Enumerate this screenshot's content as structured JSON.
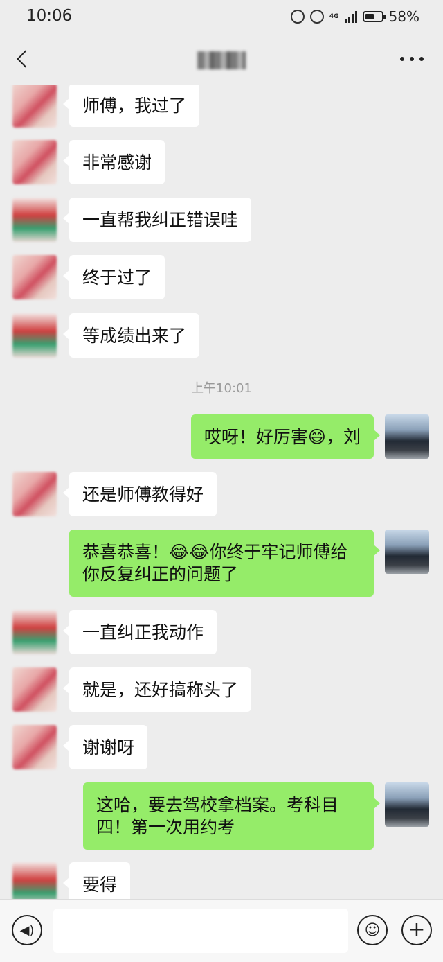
{
  "status": {
    "time": "10:06",
    "battery": "58%",
    "network": "4G"
  },
  "nav": {
    "title": ""
  },
  "chat": {
    "timestamp": "上午10:01",
    "messages": [
      {
        "side": "left",
        "text": "师傅，我过了"
      },
      {
        "side": "left",
        "text": "非常感谢"
      },
      {
        "side": "left",
        "text": "一直帮我纠正错误哇"
      },
      {
        "side": "left",
        "text": "终于过了"
      },
      {
        "side": "left",
        "text": "等成绩出来了"
      },
      {
        "side": "right",
        "text": "哎呀！好厉害😄，刘"
      },
      {
        "side": "left",
        "text": "还是师傅教得好"
      },
      {
        "side": "right",
        "text": "恭喜恭喜！😂😂你终于牢记师傅给你反复纠正的问题了"
      },
      {
        "side": "left",
        "text": "一直纠正我动作"
      },
      {
        "side": "left",
        "text": "就是，还好搞称头了"
      },
      {
        "side": "left",
        "text": "谢谢呀"
      },
      {
        "side": "right",
        "text": "这哈，要去驾校拿档案。考科目四！第一次用约考"
      },
      {
        "side": "left",
        "text": "要得"
      }
    ]
  },
  "input": {
    "value": ""
  }
}
